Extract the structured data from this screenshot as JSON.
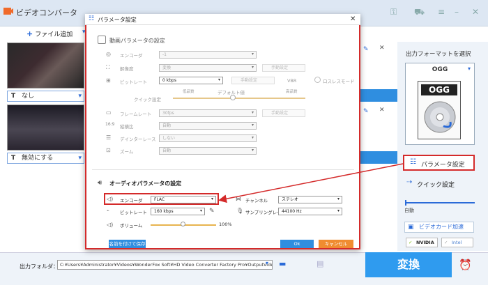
{
  "app": {
    "title": "ビデオコンバータ",
    "add_file": "ファイル追加"
  },
  "files": [
    {
      "subtitle": "なし"
    },
    {
      "subtitle": "無効にする"
    }
  ],
  "right_panel": {
    "format_label": "出力フォーマットを選択",
    "format_name": "OGG",
    "format_card": "OGG",
    "param_button": "パラメータ設定",
    "quick_settings": "クイック設定",
    "auto_label": "自動",
    "gpu_button": "ビデオカード加速",
    "gpu_badges": [
      "NVIDIA",
      "Intel"
    ]
  },
  "bottom": {
    "output_label": "出力フォルダ：",
    "output_path": "C:¥Users¥Administrator¥Videos¥WonderFox Soft¥HD Video Converter Factory Pro¥OutputVideo¥",
    "convert": "変換"
  },
  "dialog": {
    "title": "パラメータ設定",
    "video_section": "動画パラメータの設定",
    "video": {
      "encoder_label": "エンコーダ",
      "encoder_value": "-1",
      "resolution_label": "解像度",
      "resolution_value": "変換",
      "manual_1": "手動設定",
      "bitrate_label": "ビットレート",
      "bitrate_value": "0 kbps",
      "manual_2": "手動設定",
      "vbr": "VBR",
      "lossless": "ロスレスモード",
      "quality_low": "低品質",
      "quality_default": "デフォルト値",
      "quality_high": "高品質",
      "quick_setting": "クイック設定",
      "framerate_label": "フレームレート",
      "framerate_value": "30fps",
      "manual_3": "手動設定",
      "aspect_label": "縦横比",
      "aspect_value": "自動",
      "deinterlace_label": "デインターレース",
      "deinterlace_value": "しない",
      "zoom_label": "ズーム",
      "zoom_value": "自動"
    },
    "audio_section": "オーディオパラメータの設定",
    "audio": {
      "encoder_label": "エンコーダ",
      "encoder_value": "FLAC",
      "channel_label": "チャンネル",
      "channel_value": "ステレオ",
      "bitrate_label": "ビットレート",
      "bitrate_value": "160 kbps",
      "samplerate_label": "サンプリングレート",
      "samplerate_value": "44100 Hz",
      "volume_label": "ボリューム",
      "volume_value": "100%",
      "volume_level": 0.5
    },
    "buttons": {
      "save_as": "名前を付けて保存",
      "ok": "Ok",
      "cancel": "キャンセル"
    },
    "colors": {
      "ok": "#2f8ee0",
      "cancel": "#f08c30",
      "save": "#2f8ee0",
      "highlight": "#d42a2a"
    }
  }
}
